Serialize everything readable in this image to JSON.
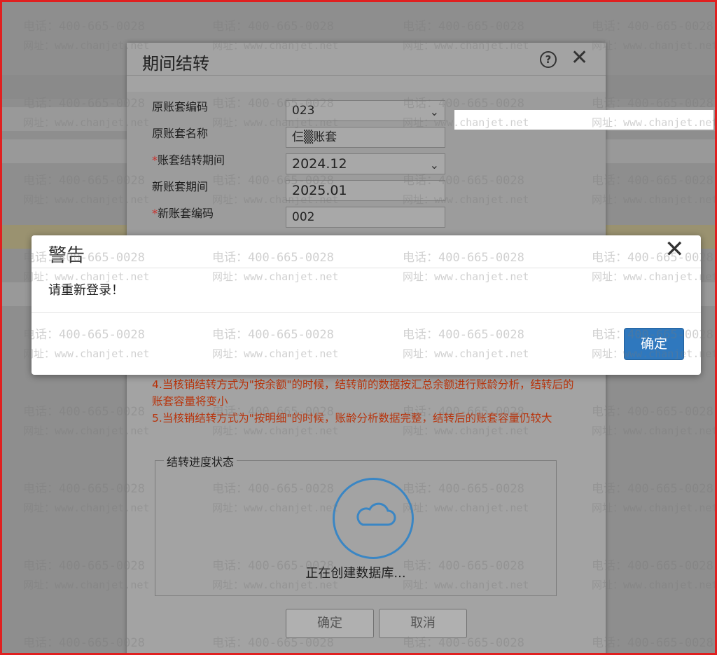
{
  "period_dialog": {
    "title": "期间结转",
    "form": [
      {
        "label": "原账套编码",
        "required": false,
        "value": "023",
        "dropdown": true
      },
      {
        "label": "原账套名称",
        "required": false,
        "value": "仨▒账套",
        "dropdown": false
      },
      {
        "label": "账套结转期间",
        "required": true,
        "value": "2024.12",
        "dropdown": true
      },
      {
        "label": "新账套期间",
        "required": false,
        "value": "2025.01",
        "dropdown": false
      },
      {
        "label": "新账套编码",
        "required": true,
        "value": "002",
        "dropdown": false
      }
    ],
    "notes": [
      "4.当核销结转方式为\"按余额\"的时候，结转前的数据按汇总余额进行账龄分析，结转后的账套容量将变小",
      "5.当核销结转方式为\"按明细\"的时候，账龄分析数据完整，结转后的账套容量仍较大"
    ],
    "progress": {
      "legend": "结转进度状态",
      "status_text": "正在创建数据库..."
    },
    "buttons": {
      "ok": "确定",
      "cancel": "取消"
    }
  },
  "warning_dialog": {
    "title": "警告",
    "message": "请重新登录！",
    "ok_label": "确定"
  },
  "watermark": {
    "phone": "电话：400-665-0028",
    "url": "网址：www.chanjet.net"
  },
  "colors": {
    "accent": "#2f78be",
    "notes": "#b8340c",
    "required": "#c9302c",
    "frame_border": "#e02020"
  }
}
